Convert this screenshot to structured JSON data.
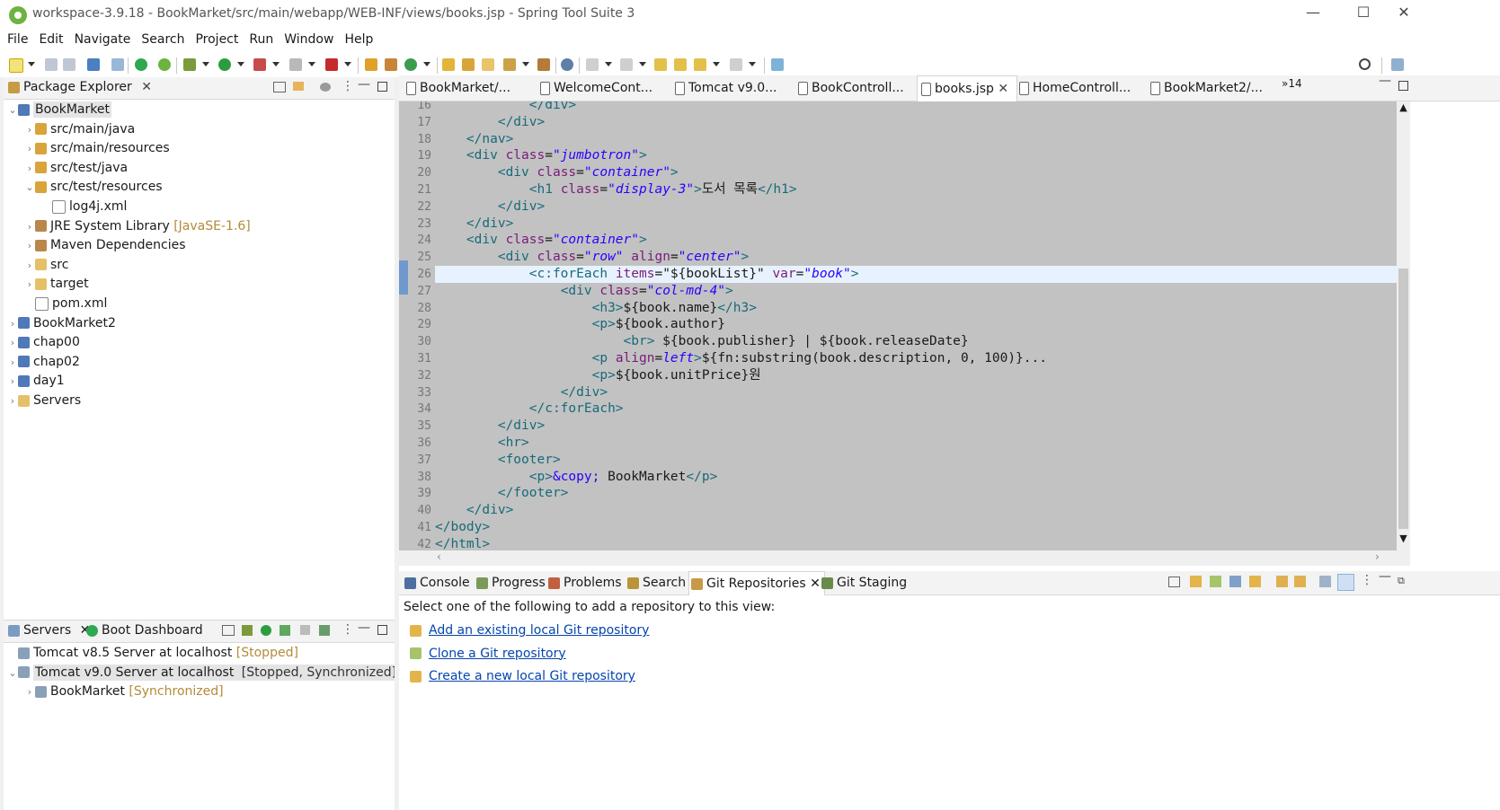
{
  "window": {
    "title": "workspace-3.9.18 - BookMarket/src/main/webapp/WEB-INF/views/books.jsp - Spring Tool Suite 3",
    "min_glyph": "—",
    "max_glyph": "☐",
    "close_glyph": "✕"
  },
  "menu": [
    "File",
    "Edit",
    "Navigate",
    "Search",
    "Project",
    "Run",
    "Window",
    "Help"
  ],
  "package_explorer": {
    "title": "Package Explorer",
    "tree": [
      {
        "label": "BookMarket",
        "suffix": "",
        "indent": 0,
        "arrow": "v",
        "icon": "project-icon",
        "selected": true
      },
      {
        "label": "src/main/java",
        "suffix": "",
        "indent": 1,
        "arrow": ">",
        "icon": "source-folder-icon"
      },
      {
        "label": "src/main/resources",
        "suffix": "",
        "indent": 1,
        "arrow": ">",
        "icon": "source-folder-icon"
      },
      {
        "label": "src/test/java",
        "suffix": "",
        "indent": 1,
        "arrow": ">",
        "icon": "source-folder-icon"
      },
      {
        "label": "src/test/resources",
        "suffix": "",
        "indent": 1,
        "arrow": "v",
        "icon": "source-folder-icon"
      },
      {
        "label": "log4j.xml",
        "suffix": "",
        "indent": 2,
        "arrow": "",
        "icon": "xml-file-icon"
      },
      {
        "label": "JRE System Library",
        "suffix": "[JavaSE-1.6]",
        "indent": 1,
        "arrow": ">",
        "icon": "library-icon"
      },
      {
        "label": "Maven Dependencies",
        "suffix": "",
        "indent": 1,
        "arrow": ">",
        "icon": "library-icon"
      },
      {
        "label": "src",
        "suffix": "",
        "indent": 1,
        "arrow": ">",
        "icon": "folder-icon"
      },
      {
        "label": "target",
        "suffix": "",
        "indent": 1,
        "arrow": ">",
        "icon": "folder-icon"
      },
      {
        "label": "pom.xml",
        "suffix": "",
        "indent": 1,
        "arrow": "",
        "icon": "maven-file-icon"
      },
      {
        "label": "BookMarket2",
        "suffix": "",
        "indent": 0,
        "arrow": ">",
        "icon": "project-icon"
      },
      {
        "label": "chap00",
        "suffix": "",
        "indent": 0,
        "arrow": ">",
        "icon": "project-icon"
      },
      {
        "label": "chap02",
        "suffix": "",
        "indent": 0,
        "arrow": ">",
        "icon": "project-icon"
      },
      {
        "label": "day1",
        "suffix": "",
        "indent": 0,
        "arrow": ">",
        "icon": "project-icon"
      },
      {
        "label": "Servers",
        "suffix": "",
        "indent": 0,
        "arrow": ">",
        "icon": "folder-icon"
      }
    ]
  },
  "servers_panel": {
    "tabs": [
      "Servers",
      "Boot Dashboard"
    ],
    "rows": [
      {
        "label": "Tomcat v8.5 Server at localhost",
        "suffix": "[Stopped]",
        "indent": 0,
        "arrow": "",
        "selected": false
      },
      {
        "label": "Tomcat v9.0 Server at localhost",
        "suffix": "[Stopped, Synchronized]",
        "indent": 0,
        "arrow": "v",
        "selected": true
      },
      {
        "label": "BookMarket",
        "suffix": "[Synchronized]",
        "indent": 1,
        "arrow": ">",
        "selected": false
      }
    ]
  },
  "editor_tabs": [
    {
      "label": "BookMarket/...",
      "active": false
    },
    {
      "label": "WelcomeCont...",
      "active": false
    },
    {
      "label": "Tomcat v9.0...",
      "active": false
    },
    {
      "label": "BookControll...",
      "active": false
    },
    {
      "label": "books.jsp",
      "active": true
    },
    {
      "label": "HomeControll...",
      "active": false
    },
    {
      "label": "BookMarket2/...",
      "active": false
    }
  ],
  "editor_overflow": "»14",
  "code_lines": [
    {
      "n": "16",
      "segs": [
        [
          "            ",
          ""
        ],
        [
          "</div>",
          "tg"
        ]
      ]
    },
    {
      "n": "17",
      "segs": [
        [
          "        ",
          ""
        ],
        [
          "</div>",
          "tg"
        ]
      ]
    },
    {
      "n": "18",
      "segs": [
        [
          "    ",
          ""
        ],
        [
          "</nav>",
          "tg"
        ]
      ]
    },
    {
      "n": "19",
      "segs": [
        [
          "    ",
          ""
        ],
        [
          "<div",
          "tg"
        ],
        [
          " ",
          ""
        ],
        [
          "class",
          "at"
        ],
        [
          "=",
          ""
        ],
        [
          "\"jumbotron\"",
          "st"
        ],
        [
          ">",
          "tg"
        ]
      ]
    },
    {
      "n": "20",
      "segs": [
        [
          "        ",
          ""
        ],
        [
          "<div",
          "tg"
        ],
        [
          " ",
          ""
        ],
        [
          "class",
          "at"
        ],
        [
          "=",
          ""
        ],
        [
          "\"container\"",
          "st"
        ],
        [
          ">",
          "tg"
        ]
      ]
    },
    {
      "n": "21",
      "segs": [
        [
          "            ",
          ""
        ],
        [
          "<h1",
          "tg"
        ],
        [
          " ",
          ""
        ],
        [
          "class",
          "at"
        ],
        [
          "=",
          ""
        ],
        [
          "\"display-3\"",
          "st"
        ],
        [
          ">",
          "tg"
        ],
        [
          "도서 목록",
          ""
        ],
        [
          "</h1>",
          "tg"
        ]
      ]
    },
    {
      "n": "22",
      "segs": [
        [
          "        ",
          ""
        ],
        [
          "</div>",
          "tg"
        ]
      ]
    },
    {
      "n": "23",
      "segs": [
        [
          "    ",
          ""
        ],
        [
          "</div>",
          "tg"
        ]
      ]
    },
    {
      "n": "24",
      "segs": [
        [
          "    ",
          ""
        ],
        [
          "<div",
          "tg"
        ],
        [
          " ",
          ""
        ],
        [
          "class",
          "at"
        ],
        [
          "=",
          ""
        ],
        [
          "\"container\"",
          "st"
        ],
        [
          ">",
          "tg"
        ]
      ]
    },
    {
      "n": "25",
      "segs": [
        [
          "        ",
          ""
        ],
        [
          "<div",
          "tg"
        ],
        [
          " ",
          ""
        ],
        [
          "class",
          "at"
        ],
        [
          "=",
          ""
        ],
        [
          "\"row\"",
          "st"
        ],
        [
          " ",
          ""
        ],
        [
          "align",
          "at"
        ],
        [
          "=",
          ""
        ],
        [
          "\"center\"",
          "st"
        ],
        [
          ">",
          "tg"
        ]
      ]
    },
    {
      "n": "26",
      "segs": [
        [
          "            ",
          ""
        ],
        [
          "<c:forEach",
          "tg"
        ],
        [
          " ",
          ""
        ],
        [
          "items",
          "at"
        ],
        [
          "=",
          ""
        ],
        [
          "\"${bookList}\"",
          ""
        ],
        [
          " ",
          ""
        ],
        [
          "var",
          "at"
        ],
        [
          "=",
          ""
        ],
        [
          "\"book\"",
          "st"
        ],
        [
          ">",
          "tg"
        ]
      ],
      "current": true
    },
    {
      "n": "27",
      "segs": [
        [
          "                ",
          ""
        ],
        [
          "<div",
          "tg"
        ],
        [
          " ",
          ""
        ],
        [
          "class",
          "at"
        ],
        [
          "=",
          ""
        ],
        [
          "\"col-md-4\"",
          "st"
        ],
        [
          ">",
          "tg"
        ]
      ]
    },
    {
      "n": "28",
      "segs": [
        [
          "                    ",
          ""
        ],
        [
          "<h3>",
          "tg"
        ],
        [
          "${book.name}",
          ""
        ],
        [
          "</h3>",
          "tg"
        ]
      ]
    },
    {
      "n": "29",
      "segs": [
        [
          "                    ",
          ""
        ],
        [
          "<p>",
          "tg"
        ],
        [
          "${book.author}",
          ""
        ]
      ]
    },
    {
      "n": "30",
      "segs": [
        [
          "                        ",
          ""
        ],
        [
          "<br>",
          "tg"
        ],
        [
          " ${book.publisher} | ${book.releaseDate}",
          ""
        ]
      ]
    },
    {
      "n": "31",
      "segs": [
        [
          "                    ",
          ""
        ],
        [
          "<p",
          "tg"
        ],
        [
          " ",
          ""
        ],
        [
          "align",
          "at"
        ],
        [
          "=",
          ""
        ],
        [
          "left",
          "st"
        ],
        [
          ">",
          "tg"
        ],
        [
          "${fn:substring(book.description, 0, 100)}...",
          ""
        ]
      ]
    },
    {
      "n": "32",
      "segs": [
        [
          "                    ",
          ""
        ],
        [
          "<p>",
          "tg"
        ],
        [
          "${book.unitPrice}원",
          ""
        ]
      ]
    },
    {
      "n": "33",
      "segs": [
        [
          "                ",
          ""
        ],
        [
          "</div>",
          "tg"
        ]
      ]
    },
    {
      "n": "34",
      "segs": [
        [
          "            ",
          ""
        ],
        [
          "</c:forEach>",
          "tg"
        ]
      ]
    },
    {
      "n": "35",
      "segs": [
        [
          "        ",
          ""
        ],
        [
          "</div>",
          "tg"
        ]
      ]
    },
    {
      "n": "36",
      "segs": [
        [
          "        ",
          ""
        ],
        [
          "<hr>",
          "tg"
        ]
      ]
    },
    {
      "n": "37",
      "segs": [
        [
          "        ",
          ""
        ],
        [
          "<footer>",
          "tg"
        ]
      ]
    },
    {
      "n": "38",
      "segs": [
        [
          "            ",
          ""
        ],
        [
          "<p>",
          "tg"
        ],
        [
          "&copy;",
          "ent"
        ],
        [
          " BookMarket",
          ""
        ],
        [
          "</p>",
          "tg"
        ]
      ]
    },
    {
      "n": "39",
      "segs": [
        [
          "        ",
          ""
        ],
        [
          "</footer>",
          "tg"
        ]
      ]
    },
    {
      "n": "40",
      "segs": [
        [
          "    ",
          ""
        ],
        [
          "</div>",
          "tg"
        ]
      ]
    },
    {
      "n": "41",
      "segs": [
        [
          "</body>",
          "tg"
        ]
      ]
    },
    {
      "n": "42",
      "segs": [
        [
          "</html>",
          "tg"
        ]
      ]
    }
  ],
  "bottom_tabs": [
    "Console",
    "Progress",
    "Problems",
    "Search",
    "Git Repositories",
    "Git Staging"
  ],
  "git_panel": {
    "intro": "Select one of the following to add a repository to this view:",
    "links": [
      "Add an existing local Git repository",
      "Clone a Git repository",
      "Create a new local Git repository"
    ]
  },
  "colors": {
    "accent": "#6db33f",
    "link": "#0645ad",
    "editor_bg": "#c2c2c2",
    "current_line": "#e8f2fe"
  }
}
